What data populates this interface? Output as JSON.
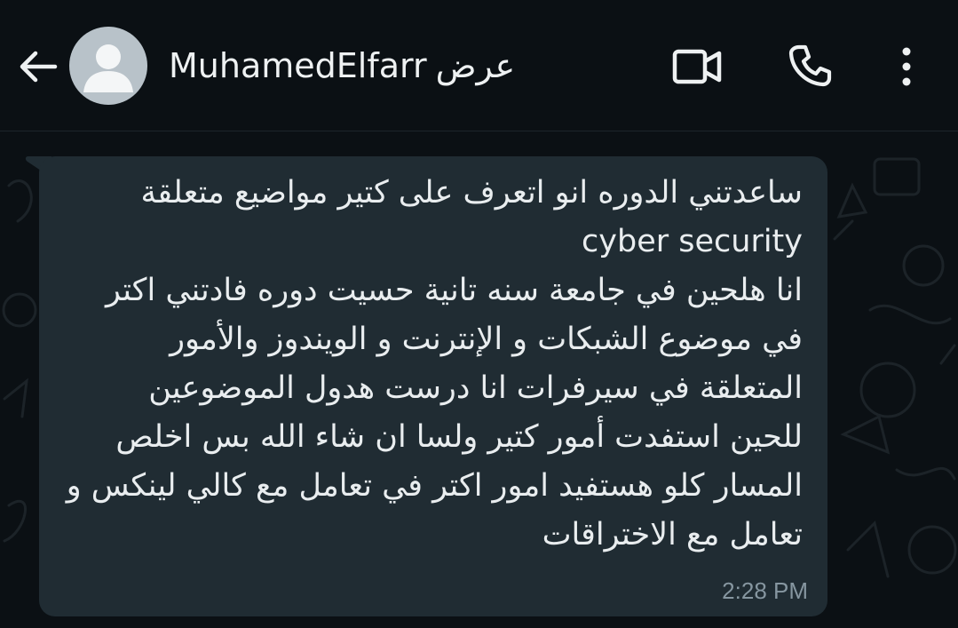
{
  "header": {
    "contact_name": "MuhamedElfarr",
    "contact_tag": "عرض",
    "back_icon": "arrow-left-icon",
    "avatar_icon": "default-avatar-icon",
    "video_icon": "video-call-icon",
    "call_icon": "phone-icon",
    "menu_icon": "more-vertical-icon"
  },
  "message": {
    "lines": [
      "ساعدتني الدوره انو اتعرف على كتير مواضيع متعلقة",
      "cyber security",
      "انا هلحين في جامعة سنه تانية حسيت دوره فادتني اكتر",
      "في موضوع الشبكات و الإنترنت و الويندوز والأمور",
      "المتعلقة في سيرفرات انا درست هدول الموضوعين",
      "للحين استفدت أمور كتير ولسا ان شاء الله بس اخلص",
      "المسار كلو هستفيد امور اكتر في تعامل مع كالي لينكس و",
      "تعامل مع الاختراقات"
    ],
    "time": "2:28 PM"
  },
  "colors": {
    "background": "#0b1014",
    "bubble": "#202c33",
    "text": "#e9edef",
    "time": "#8696a0",
    "avatar": "#b8c2c9"
  }
}
